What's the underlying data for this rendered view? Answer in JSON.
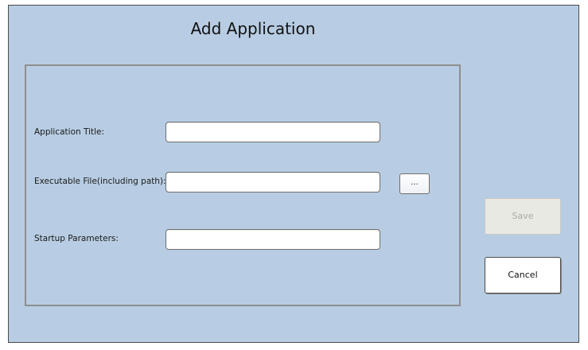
{
  "dialog": {
    "title": "Add Application"
  },
  "form": {
    "application_title": {
      "label": "Application Title:",
      "value": ""
    },
    "executable_file": {
      "label": "Executable File(including path):",
      "value": "",
      "browse_label": "..."
    },
    "startup_parameters": {
      "label": "Startup Parameters:",
      "value": ""
    }
  },
  "actions": {
    "save_label": "Save",
    "save_enabled": false,
    "cancel_label": "Cancel"
  },
  "colors": {
    "background": "#b8cde3",
    "frame_border": "#8e8e8e",
    "disabled_text": "#a8a8a8"
  }
}
